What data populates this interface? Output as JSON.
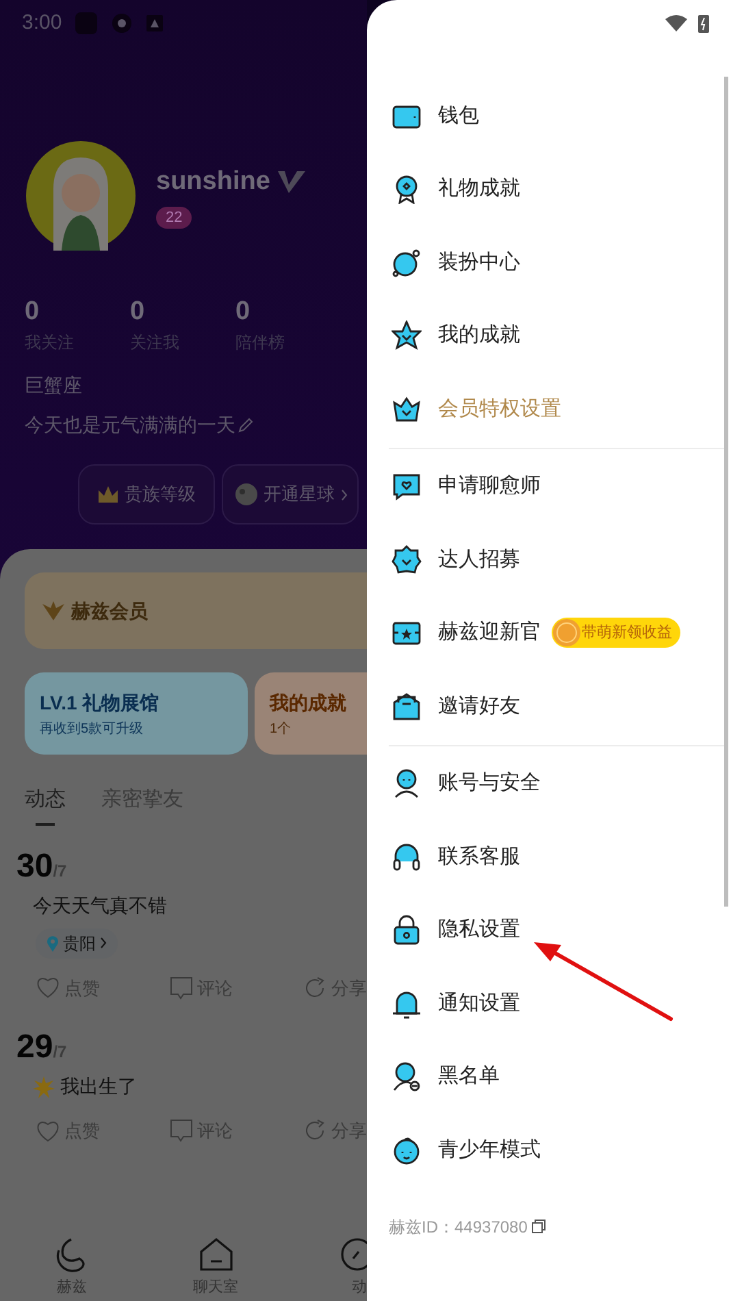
{
  "status_bar": {
    "time": "3:00"
  },
  "profile": {
    "name": "sunshine",
    "level": "22",
    "stats": [
      {
        "value": "0",
        "label": "我关注"
      },
      {
        "value": "0",
        "label": "关注我"
      },
      {
        "value": "0",
        "label": "陪伴榜"
      }
    ],
    "constellation": "巨蟹座",
    "bio": "今天也是元气满满的一天",
    "buttons": [
      {
        "label": "贵族等级",
        "kind": "crown"
      },
      {
        "label": "开通星球",
        "kind": "planet"
      }
    ]
  },
  "member_card": {
    "title": "赫兹会员"
  },
  "feature_cards": [
    {
      "kind": "gift",
      "title": "LV.1 礼物展馆",
      "subtitle": "再收到5款可升级"
    },
    {
      "kind": "achievement",
      "title": "我的成就",
      "subtitle": "1个"
    }
  ],
  "tabs": [
    {
      "label": "动态",
      "selected": true
    },
    {
      "label": "亲密挚友",
      "selected": false
    }
  ],
  "posts": [
    {
      "kind": "location",
      "day": "30",
      "month": "/7",
      "text": "今天天气真不错",
      "location": "贵阳",
      "actions": [
        "点赞",
        "评论",
        "分享"
      ]
    },
    {
      "day": "29",
      "month": "/7",
      "kind": "mood",
      "text": "我出生了",
      "actions": [
        "点赞",
        "评论",
        "分享"
      ]
    }
  ],
  "bottom_nav": [
    {
      "label": "赫兹"
    },
    {
      "label": "聊天室"
    },
    {
      "label": "动"
    }
  ],
  "drawer": {
    "groups": [
      [
        {
          "label": "钱包",
          "kind": "normal"
        },
        {
          "label": "礼物成就",
          "kind": "normal"
        },
        {
          "label": "装扮中心",
          "kind": "normal"
        },
        {
          "label": "我的成就",
          "kind": "normal"
        },
        {
          "label": "会员特权设置",
          "kind": "vip"
        }
      ],
      [
        {
          "label": "申请聊愈师",
          "kind": "normal"
        },
        {
          "label": "达人招募",
          "kind": "normal"
        },
        {
          "label": "赫兹迎新官",
          "kind": "normal",
          "badge": "带萌新领收益"
        },
        {
          "label": "邀请好友",
          "kind": "normal"
        }
      ],
      [
        {
          "label": "账号与安全",
          "kind": "normal"
        },
        {
          "label": "联系客服",
          "kind": "normal"
        },
        {
          "label": "隐私设置",
          "kind": "normal"
        },
        {
          "label": "通知设置",
          "kind": "normal"
        },
        {
          "label": "黑名单",
          "kind": "normal"
        },
        {
          "label": "青少年模式",
          "kind": "normal"
        }
      ]
    ],
    "user_id": "赫兹ID：44937080"
  }
}
